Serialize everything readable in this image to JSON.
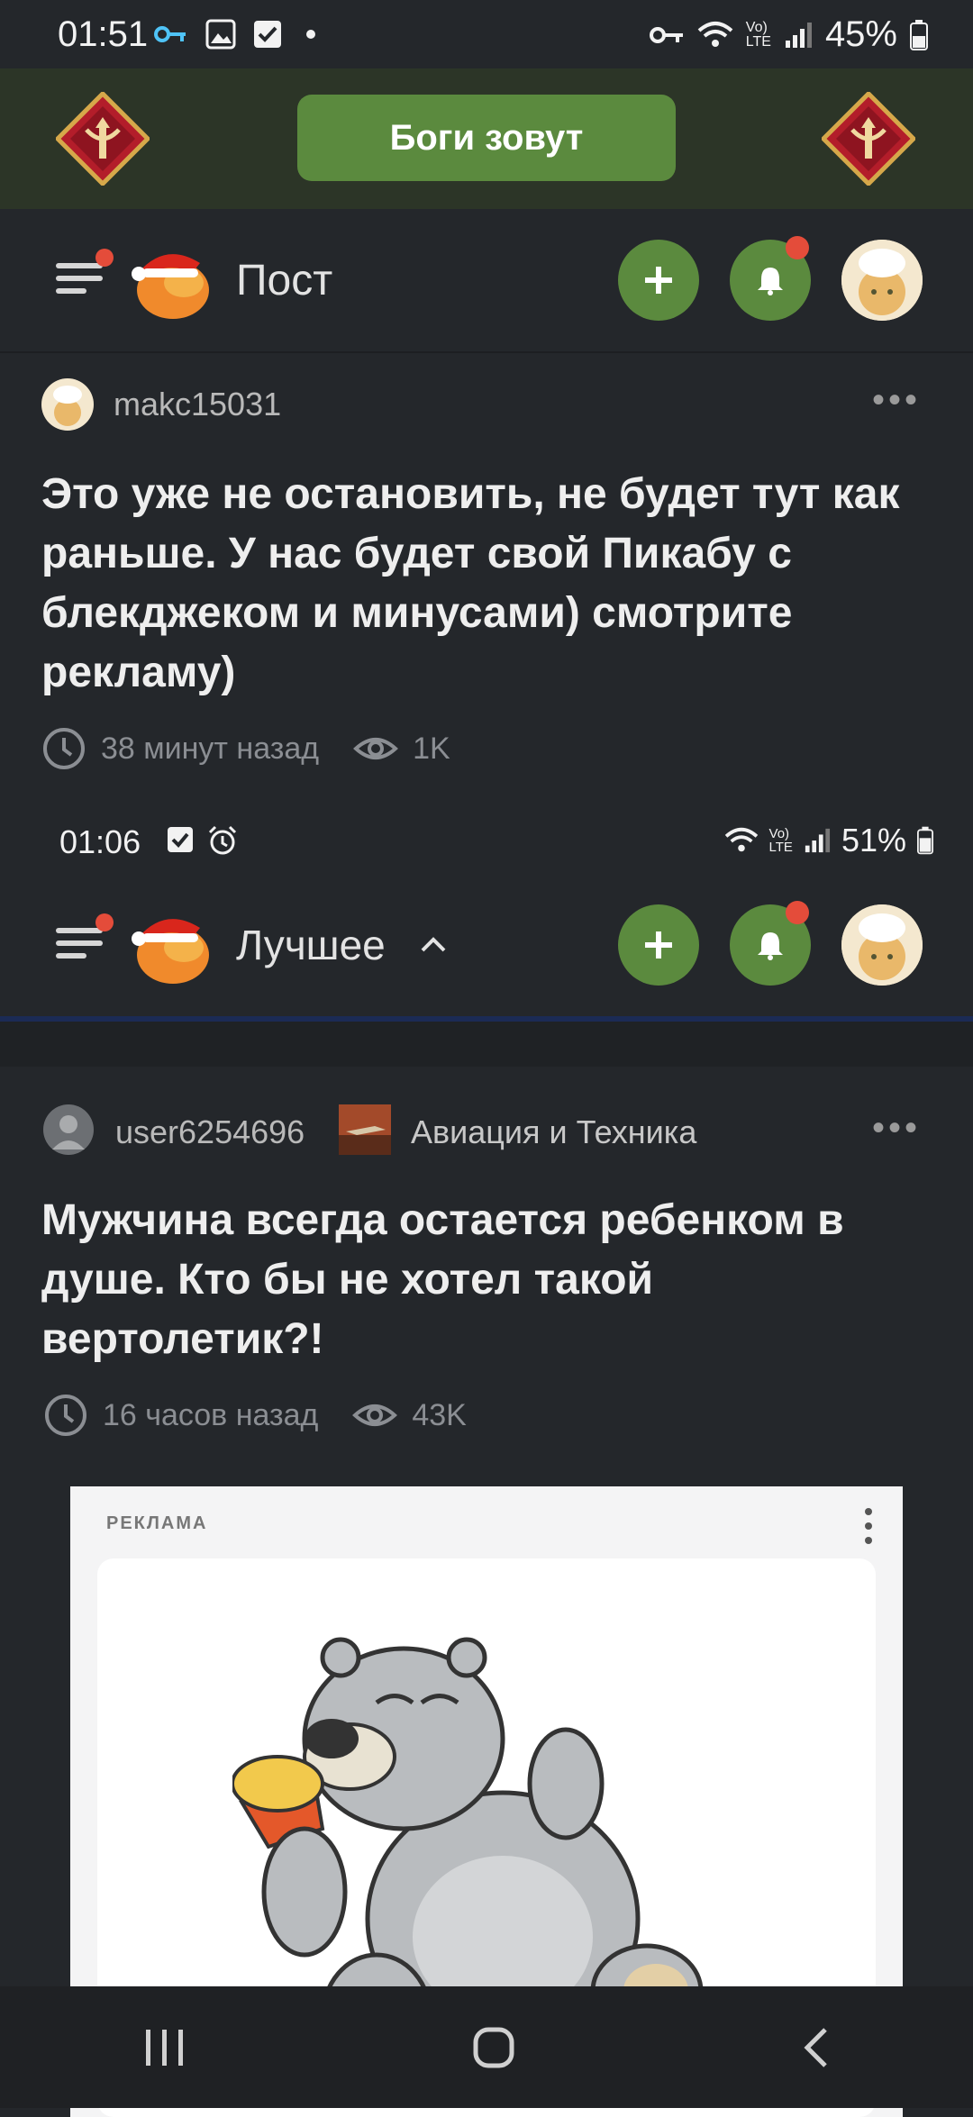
{
  "status_bar": {
    "time": "01:51",
    "battery": "45%"
  },
  "promo": {
    "button_label": "Боги зовут"
  },
  "header": {
    "title": "Пост"
  },
  "post1": {
    "author": "makc15031",
    "title": "Это уже не остановить, не будет тут как раньше. У нас будет свой Пикабу с блекджеком и минусами) смотрите рекламу)",
    "time": "38 минут назад",
    "views": "1K"
  },
  "screenshot_status_bar": {
    "time": "01:06",
    "battery": "51%"
  },
  "screenshot_header": {
    "title": "Лучшее"
  },
  "post2": {
    "author": "user6254696",
    "community": "Авиация и Техника",
    "title": "Мужчина всегда остается ребенком в душе. Кто бы не хотел такой вертолетик?!",
    "time": "16 часов назад",
    "views": "43K"
  },
  "ad": {
    "label": "РЕКЛАМА"
  },
  "colors": {
    "background": "#24272b",
    "accent": "#5b8a3e",
    "badge": "#e44c3a"
  }
}
